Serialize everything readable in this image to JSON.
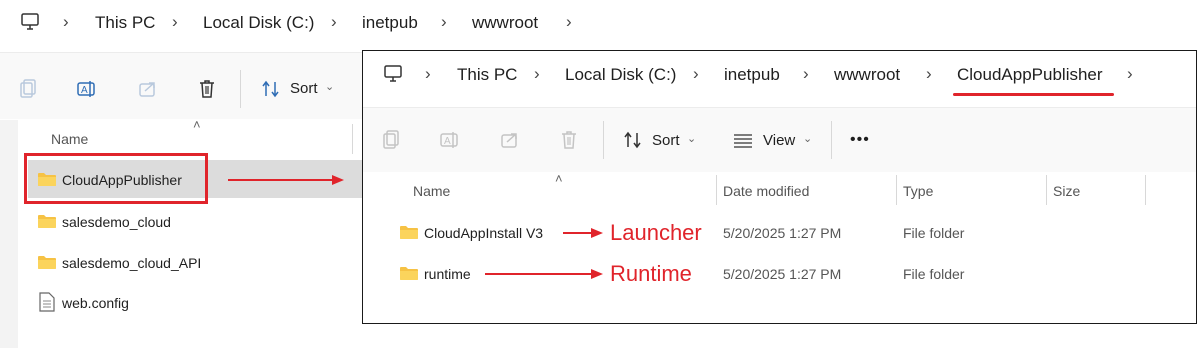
{
  "back_window": {
    "breadcrumb": [
      "This PC",
      "Local Disk (C:)",
      "inetpub",
      "wwwroot"
    ],
    "toolbar": {
      "sort_label": "Sort"
    },
    "header": {
      "name": "Name"
    },
    "items": [
      {
        "name": "CloudAppPublisher",
        "type": "folder"
      },
      {
        "name": "salesdemo_cloud",
        "type": "folder"
      },
      {
        "name": "salesdemo_cloud_API",
        "type": "folder"
      },
      {
        "name": "web.config",
        "type": "file"
      }
    ]
  },
  "front_window": {
    "breadcrumb": [
      "This PC",
      "Local Disk (C:)",
      "inetpub",
      "wwwroot",
      "CloudAppPublisher"
    ],
    "toolbar": {
      "sort_label": "Sort",
      "view_label": "View",
      "more_label": "•••"
    },
    "headers": {
      "name": "Name",
      "date": "Date modified",
      "type": "Type",
      "size": "Size"
    },
    "items": [
      {
        "name": "CloudAppInstall V3",
        "date": "5/20/2025 1:27 PM",
        "type": "File folder",
        "annotation": "Launcher"
      },
      {
        "name": "runtime",
        "date": "5/20/2025 1:27 PM",
        "type": "File folder",
        "annotation": "Runtime"
      }
    ]
  },
  "colors": {
    "highlight": "#e0242b",
    "folder": "#f6c244",
    "selected_bg": "#dcdcdc"
  }
}
